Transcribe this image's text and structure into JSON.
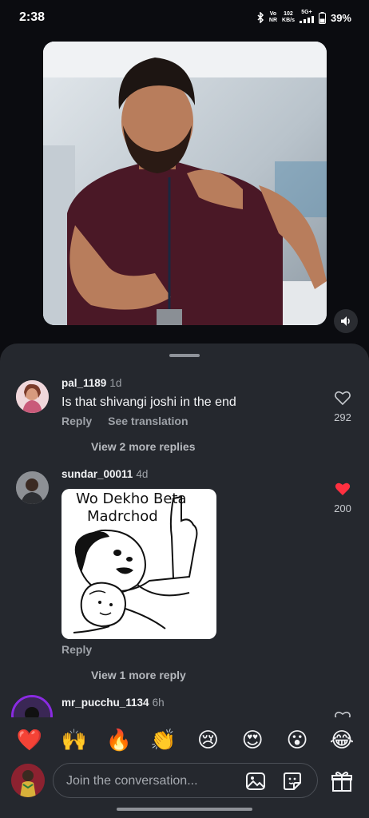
{
  "status_bar": {
    "time": "2:38",
    "volte_top": "Vo",
    "volte_bottom": "NR",
    "speed_top": "102",
    "speed_bottom": "KB/s",
    "network": "5G+",
    "battery": "39%",
    "icons": [
      "bluetooth-icon",
      "signal-icon",
      "battery-icon"
    ]
  },
  "video": {
    "mute_icon": "speaker-icon"
  },
  "comments": [
    {
      "username": "pal_1189",
      "time": "1d",
      "text": "Is that shivangi joshi in the end",
      "actions": [
        "Reply",
        "See translation"
      ],
      "likes": "292",
      "liked": false,
      "view_more": "View 2 more replies"
    },
    {
      "username": "sundar_00011",
      "time": "4d",
      "meme_lines": [
        "Wo Dekho Beta",
        "Madrchod"
      ],
      "actions": [
        "Reply"
      ],
      "likes": "200",
      "liked": true,
      "view_more": "View 1 more reply"
    },
    {
      "username": "mr_pucchu_1134",
      "time": "6h"
    }
  ],
  "emoji_bar": [
    "❤️",
    "🙌",
    "🔥",
    "👏",
    "😢",
    "😍",
    "😮",
    "😂"
  ],
  "composer": {
    "placeholder": "Join the conversation..."
  },
  "colors": {
    "sheet_bg": "#25282e",
    "like_red": "#ff3040",
    "muted_text": "#9ea2a8"
  }
}
